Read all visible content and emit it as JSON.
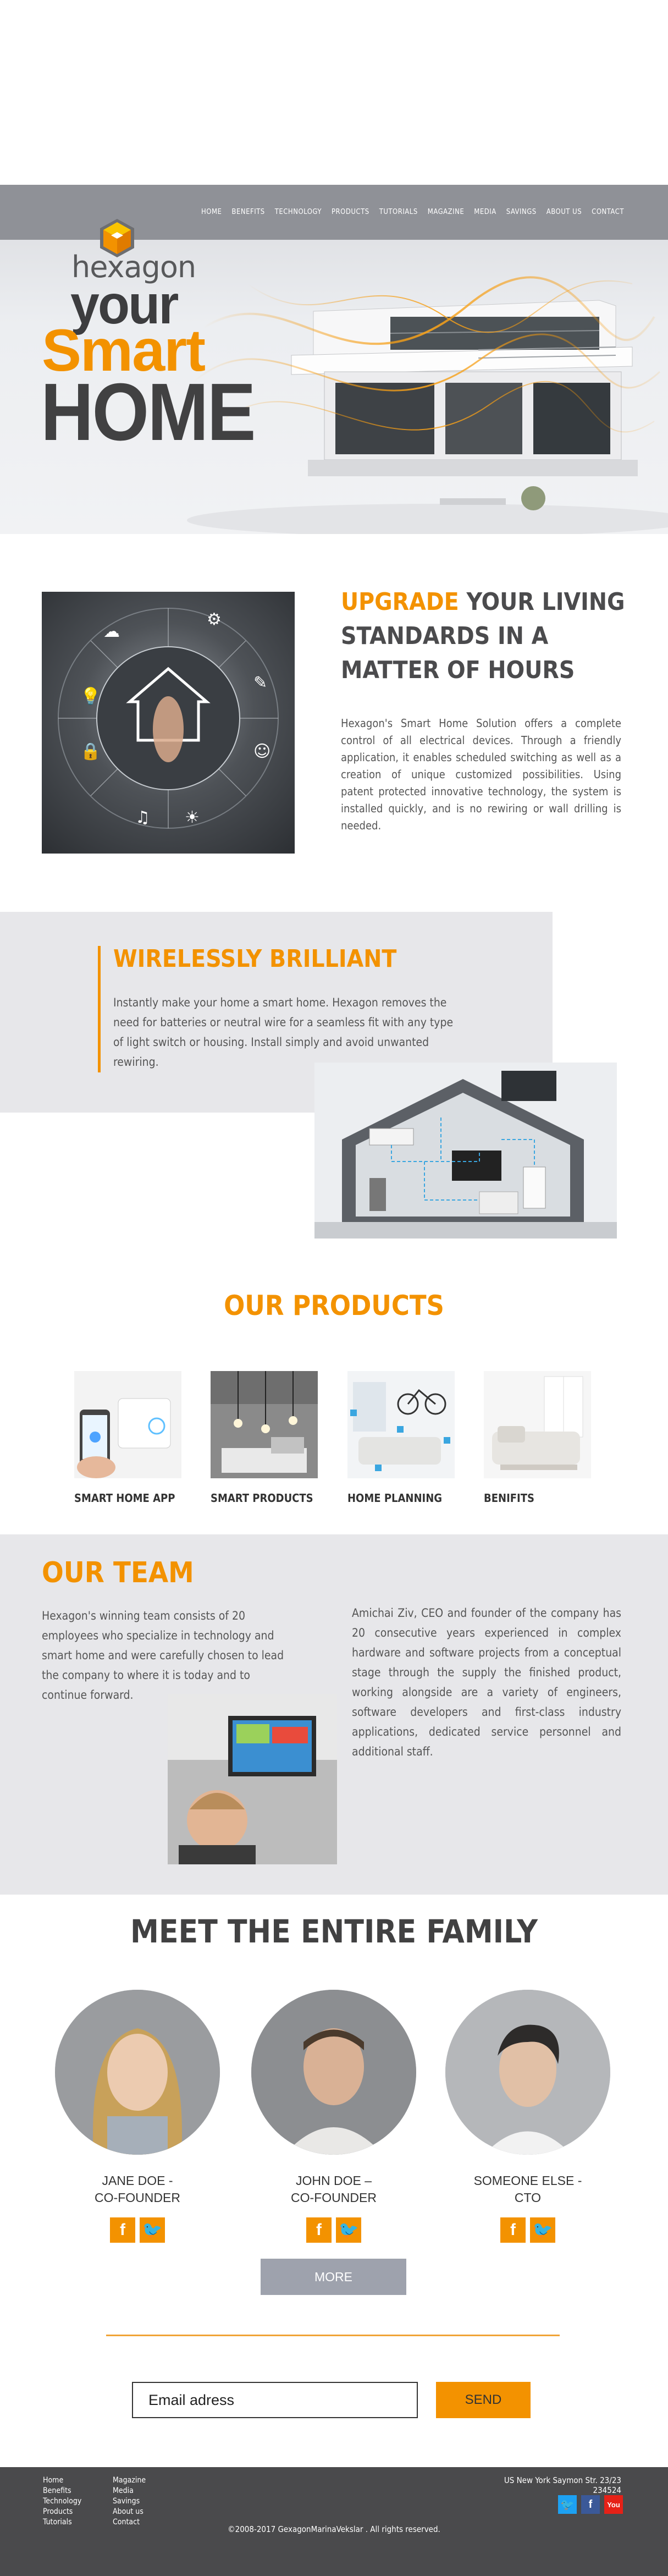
{
  "nav": {
    "items": [
      "HOME",
      "BENEFITS",
      "TECHNOLOGY",
      "PRODUCTS",
      "TUTORIALS",
      "MAGAZINE",
      "MEDIA",
      "SAVINGS",
      "ABOUT US",
      "CONTACT"
    ]
  },
  "hero": {
    "logo": "hexagon",
    "line1": "your",
    "line2": "Smart",
    "line3": "HOME"
  },
  "upgrade": {
    "title_highlight": "UPGRADE",
    "title_rest": " YOUR LIVING STANDARDS IN A MATTER OF HOURS",
    "text": "Hexagon's Smart Home Solution offers a complete control of all electrical devices. Through a friendly application, it enables scheduled switching as well as a creation of unique customized possibilities. Using patent protected innovative technology, the system is installed quickly, and is no rewiring or wall drilling is needed."
  },
  "wireless": {
    "title": "WIRELESSLY BRILLIANT",
    "text": "Instantly make your home a smart home. Hexagon removes the need for batteries or neutral wire for a seamless fit with any type of light switch or housing. Install simply and avoid unwanted rewiring."
  },
  "products": {
    "title": "OUR PRODUCTS",
    "items": [
      {
        "label": "SMART HOME APP"
      },
      {
        "label": "SMART PRODUCTS"
      },
      {
        "label": "HOME PLANNING"
      },
      {
        "label": "BENIFITS"
      }
    ]
  },
  "team": {
    "title": "OUR TEAM",
    "text_left": "Hexagon's winning team consists of 20 employees who specialize in technology and smart home and were carefully chosen to lead the company to where it is today and to continue forward.",
    "text_right": "Amichai Ziv, CEO and founder of the company has 20 consecutive years experienced in complex hardware and software projects from a conceptual stage through the supply the finished product, working alongside are a variety of engineers, software developers and first-class industry applications, dedicated service personnel and additional staff."
  },
  "family": {
    "title": "MEET THE ENTIRE FAMILY",
    "members": [
      {
        "name": "JANE DOE -",
        "role": "CO-FOUNDER"
      },
      {
        "name": "JOHN DOE –",
        "role": "CO-FOUNDER"
      },
      {
        "name": "SOMEONE ELSE -",
        "role": "CTO"
      }
    ],
    "more_label": "MORE"
  },
  "newsletter": {
    "email_placeholder": "Email adress",
    "send_label": "SEND"
  },
  "footer": {
    "col1": [
      "Home",
      "Benefits",
      "Technology",
      "Products",
      "Tutorials"
    ],
    "col2": [
      "Magazine",
      "Media",
      "Savings",
      "About us",
      "Contact"
    ],
    "address": "US New York Saymon Str. 23/23 234524",
    "copyright": "©2008-2017 GexagonMarinaVekslar . All rights reserved."
  },
  "colors": {
    "accent": "#f39200",
    "dark_text": "#414142",
    "light_bg": "#e7e7ea",
    "footer_bg": "#4a4a4c",
    "twitter": "#1da1f2",
    "facebook": "#3b5998",
    "youtube": "#e62117"
  },
  "icons": [
    "hexagon-logo-icon",
    "home-icon",
    "facebook-icon",
    "twitter-icon",
    "youtube-icon"
  ]
}
